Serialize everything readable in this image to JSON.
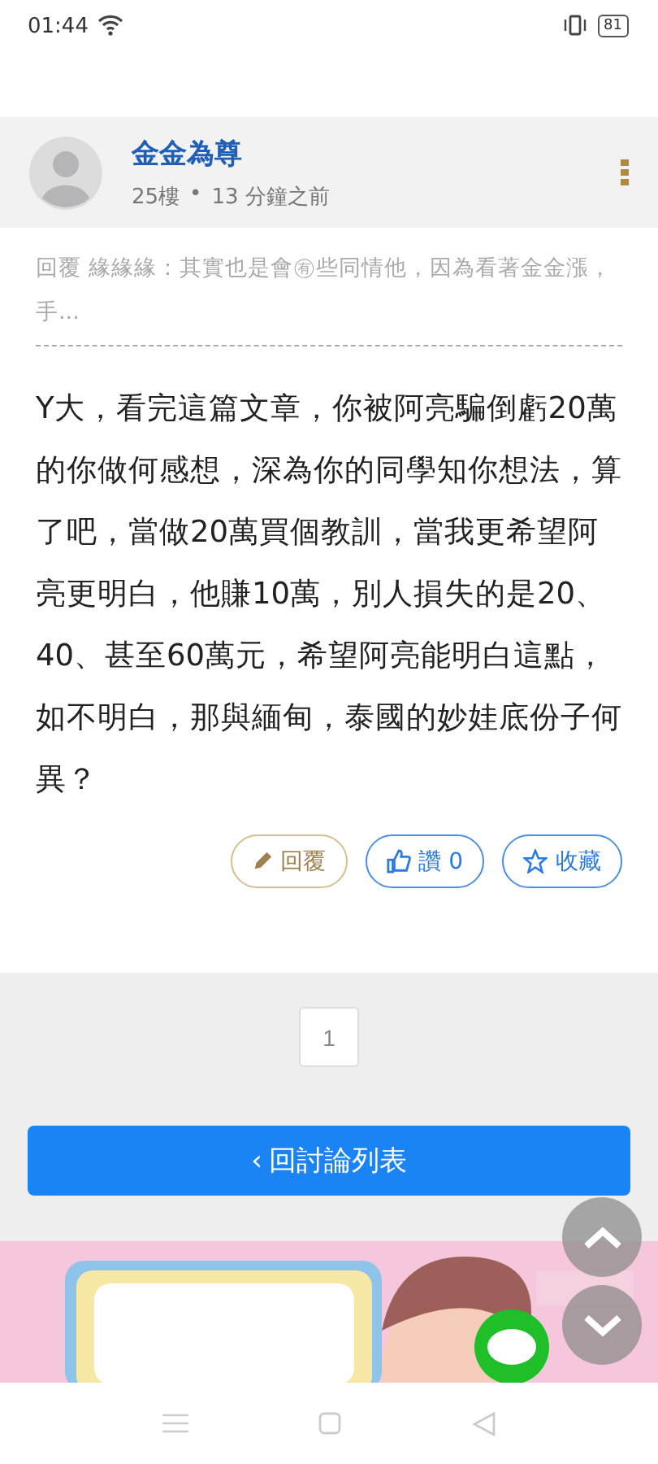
{
  "status_bar": {
    "time": "01:44",
    "battery": "81"
  },
  "post": {
    "author": "金金為尊",
    "floor": "25樓",
    "separator": "•",
    "time": "13 分鐘之前",
    "quote": "回覆 緣緣緣：其實也是會㊒些同情他，因為看著金金漲，手...",
    "body": "Y大，看完這篇文章，你被阿亮騙倒虧20萬的你做何感想，深為你的同學知你想法，算了吧，當做20萬買個教訓，當我更希望阿亮更明白，他賺10萬，別人損失的是20、40、甚至60萬元，希望阿亮能明白這點，如不明白，那與緬甸，泰國的妙娃底份子何異？",
    "actions": [
      {
        "kind": "reply",
        "label": "回覆"
      },
      {
        "kind": "like",
        "label": "讚 0"
      },
      {
        "kind": "save",
        "label": "收藏"
      }
    ]
  },
  "pagination": [
    {
      "label": "1",
      "selected": false
    }
  ],
  "back_button": {
    "arrow": "‹",
    "label": "回討論列表"
  }
}
